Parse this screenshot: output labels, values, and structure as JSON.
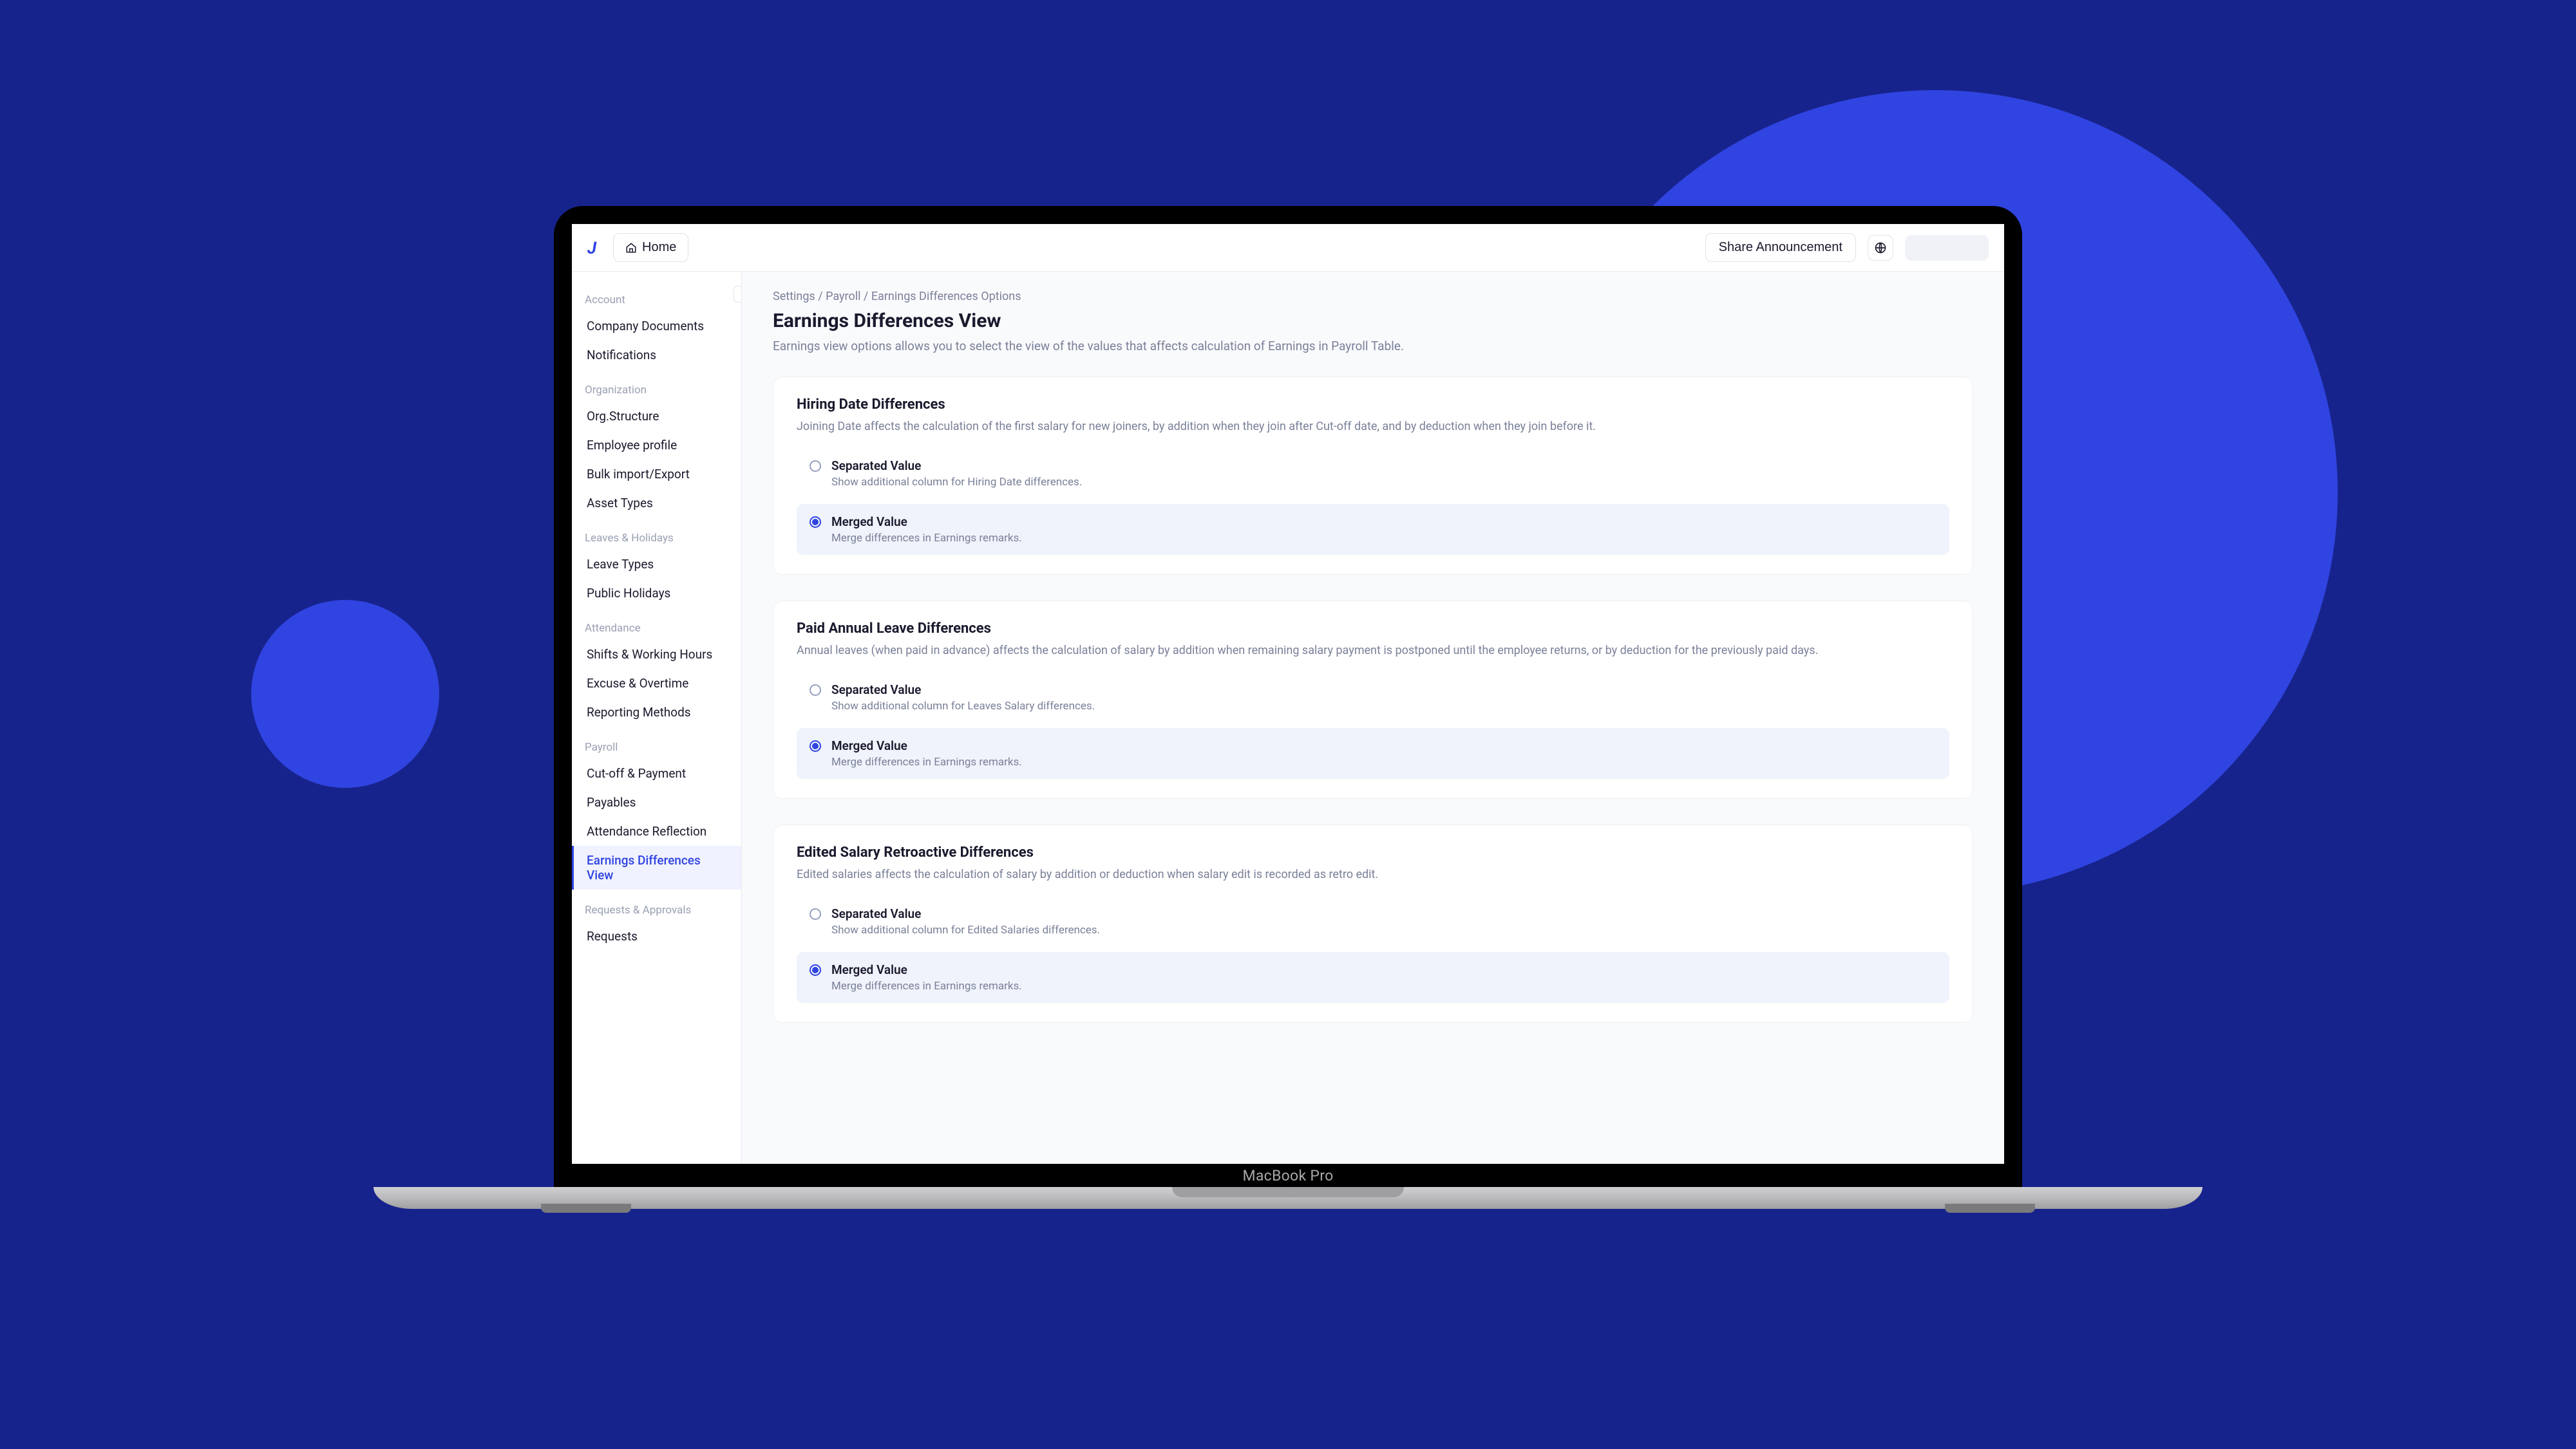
{
  "topbar": {
    "home_label": "Home",
    "share_label": "Share Announcement"
  },
  "sidebar": {
    "sections": [
      {
        "header": "Account",
        "items": [
          "Company Documents",
          "Notifications"
        ]
      },
      {
        "header": "Organization",
        "items": [
          "Org.Structure",
          "Employee profile",
          "Bulk import/Export",
          "Asset Types"
        ]
      },
      {
        "header": "Leaves & Holidays",
        "items": [
          "Leave Types",
          "Public Holidays"
        ]
      },
      {
        "header": "Attendance",
        "items": [
          "Shifts & Working Hours",
          "Excuse & Overtime",
          "Reporting Methods"
        ]
      },
      {
        "header": "Payroll",
        "items": [
          "Cut-off & Payment",
          "Payables",
          "Attendance Reflection",
          "Earnings Differences View"
        ]
      },
      {
        "header": "Requests & Approvals",
        "items": [
          "Requests"
        ]
      }
    ],
    "active_item": "Earnings Differences View"
  },
  "breadcrumb": "Settings / Payroll / Earnings Differences Options",
  "page": {
    "title": "Earnings Differences View",
    "subtitle": "Earnings view options allows you to select the view of the values that affects calculation of Earnings in Payroll Table."
  },
  "cards": [
    {
      "title": "Hiring Date Differences",
      "desc": "Joining Date affects the calculation of the first salary for new joiners, by addition when they join after Cut-off date, and by deduction when they join before it.",
      "option_a": {
        "title": "Separated Value",
        "sub": "Show additional column for Hiring Date differences."
      },
      "option_b": {
        "title": "Merged Value",
        "sub": "Merge differences in Earnings remarks."
      }
    },
    {
      "title": "Paid Annual Leave Differences",
      "desc": "Annual leaves (when paid in advance) affects the calculation of salary by addition when remaining salary payment is postponed until the employee returns, or by deduction for the previously paid days.",
      "option_a": {
        "title": "Separated Value",
        "sub": "Show additional column for Leaves Salary differences."
      },
      "option_b": {
        "title": "Merged Value",
        "sub": "Merge differences in Earnings remarks."
      }
    },
    {
      "title": "Edited Salary Retroactive Differences",
      "desc": "Edited salaries affects the calculation of salary by addition or deduction when salary edit is recorded as retro edit.",
      "option_a": {
        "title": "Separated Value",
        "sub": "Show additional column for Edited Salaries differences."
      },
      "option_b": {
        "title": "Merged Value",
        "sub": "Merge differences in Earnings remarks."
      }
    }
  ],
  "device_label": "MacBook Pro"
}
